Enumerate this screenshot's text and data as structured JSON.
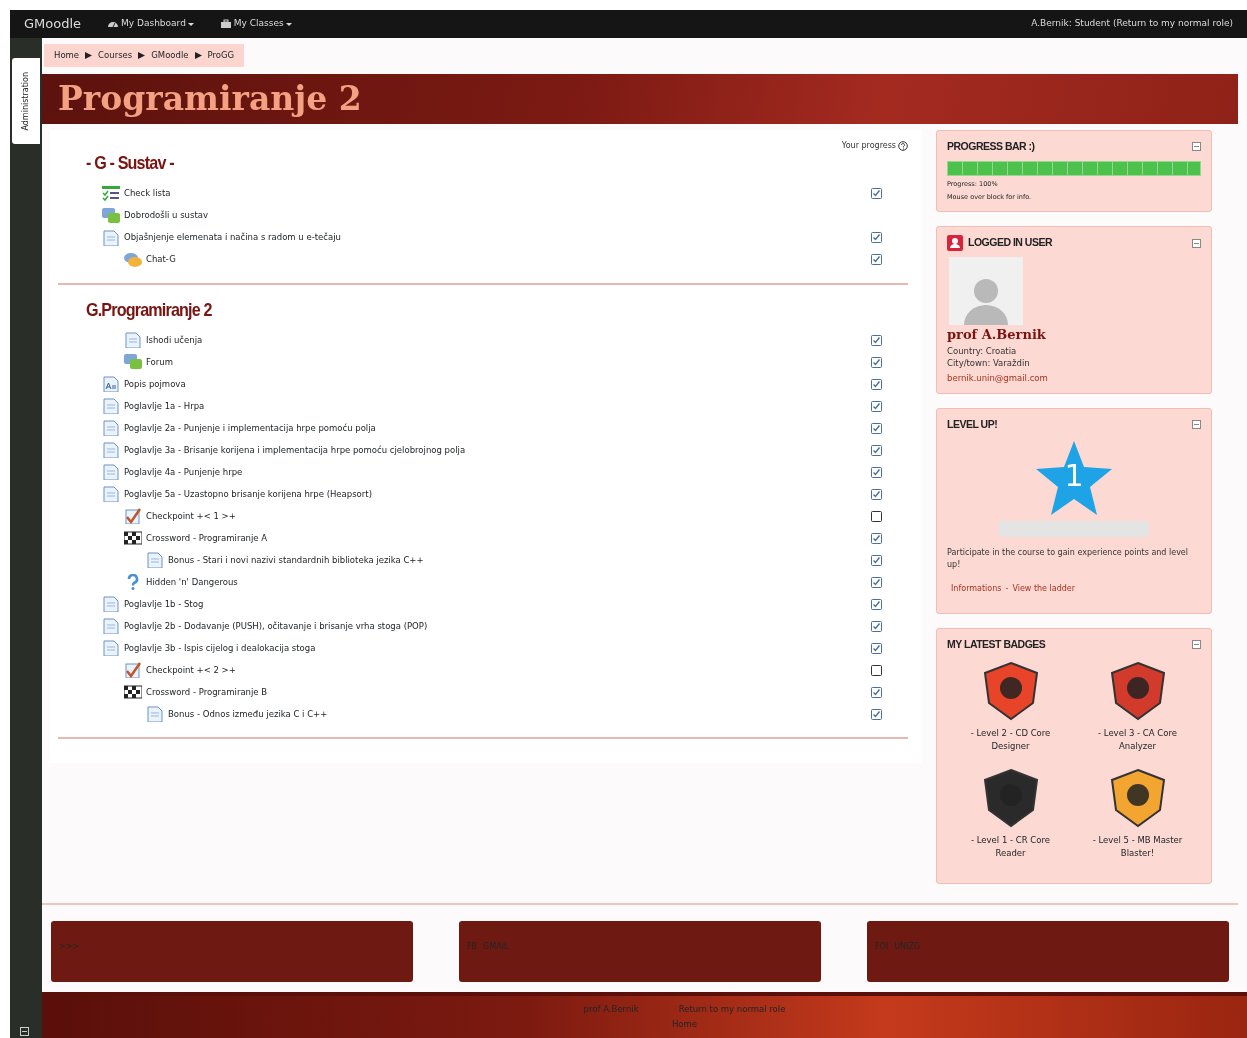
{
  "navbar": {
    "brand": "GMoodle",
    "menus": [
      {
        "label": "My Dashboard"
      },
      {
        "label": "My Classes"
      }
    ],
    "user_text": "A.Bernik: Student (Return to my normal role)"
  },
  "side_tab": {
    "label": "Administration"
  },
  "breadcrumb": [
    {
      "label": "Home"
    },
    {
      "label": "Courses"
    },
    {
      "label": "GMoodle"
    },
    {
      "label": "ProGG"
    }
  ],
  "course_title": "Programiranje 2",
  "progress_header": {
    "label": "Your progress"
  },
  "sections": [
    {
      "title": "- G - Sustav -",
      "activities": [
        {
          "kind": "checklist",
          "label": "Check lista",
          "checked": true
        },
        {
          "kind": "forum",
          "label": "Dobrodošli u sustav"
        },
        {
          "kind": "page",
          "label": "Objašnjenje elemenata i načina s radom u e-tečaju",
          "checked": true,
          "children": [
            {
              "kind": "chat",
              "label": "Chat-G",
              "checked": true
            }
          ]
        }
      ]
    },
    {
      "title": "G.Programiranje 2",
      "activities": [
        {
          "kind": "group",
          "children": [
            {
              "kind": "page",
              "label": "Ishodi učenja",
              "checked": true
            },
            {
              "kind": "forum",
              "label": "Forum",
              "checked": true
            }
          ]
        },
        {
          "kind": "glossary",
          "label": "Popis pojmova",
          "checked": true
        },
        {
          "kind": "page",
          "label": "Poglavlje 1a - Hrpa",
          "checked": true
        },
        {
          "kind": "page",
          "label": "Poglavlje 2a - Punjenje i implementacija hrpe pomoću polja",
          "checked": true
        },
        {
          "kind": "page",
          "label": "Poglavlje 3a - Brisanje korijena i implementacija hrpe pomoću cjelobrojnog polja",
          "checked": true
        },
        {
          "kind": "page",
          "label": "Poglavlje 4a - Punjenje hrpe",
          "checked": true
        },
        {
          "kind": "page",
          "label": "Poglavlje 5a - Uzastopno brisanje korijena hrpe (Heapsort)",
          "checked": true,
          "children": [
            {
              "kind": "checkpoint",
              "label": "Checkpoint +< 1 >+",
              "checked": false
            },
            {
              "kind": "crossword",
              "label": "Crossword - Programiranje A",
              "checked": true,
              "children": [
                {
                  "kind": "page",
                  "label": "Bonus - Stari i novi nazivi standardnih biblioteka jezika C++",
                  "checked": true
                }
              ]
            },
            {
              "kind": "question",
              "label": "Hidden 'n' Dangerous",
              "checked": true
            }
          ]
        },
        {
          "kind": "page",
          "label": "Poglavlje 1b - Stog",
          "checked": true
        },
        {
          "kind": "page",
          "label": "Poglavlje 2b - Dodavanje (PUSH), očitavanje i brisanje vrha stoga (POP)",
          "checked": true
        },
        {
          "kind": "page",
          "label": "Poglavlje 3b - Ispis cijelog i dealokacija stoga",
          "checked": true,
          "children": [
            {
              "kind": "checkpoint",
              "label": "Checkpoint +< 2 >+",
              "checked": false
            },
            {
              "kind": "crossword",
              "label": "Crossword - Programiranje B",
              "checked": true,
              "children": [
                {
                  "kind": "page",
                  "label": "Bonus - Odnos između jezika C i C++",
                  "checked": true
                }
              ]
            }
          ]
        }
      ]
    }
  ],
  "blocks": [
    {
      "kind": "progress",
      "title": "PROGRESS BAR :)",
      "level": 1.0,
      "lines": [
        "Progress: 100%",
        "Mouse over block for info."
      ]
    },
    {
      "kind": "user",
      "title": "LOGGED IN USER",
      "name": "prof A.Bernik",
      "lines": [
        "Country: Croatia",
        "City/town: Varaždin"
      ],
      "email": "bernik.unin@gmail.com"
    },
    {
      "kind": "levelup",
      "title": "LEVEL UP!",
      "level_number": "1",
      "text": "Participate in the course to gain experience points and level up!",
      "links": [
        "Informations",
        "View the ladder"
      ],
      "separator": "-"
    },
    {
      "kind": "badges",
      "title": "MY LATEST BADGES",
      "badges": [
        {
          "label": "- Level 2 - CD Core Designer",
          "color": "#e8442a"
        },
        {
          "label": "- Level 3 - CA Core Analyzer",
          "color": "#d23a2c"
        },
        {
          "label": "- Level 1 - CR Core Reader",
          "color": "#2a2a2a"
        },
        {
          "label": "- Level 5 - MB Master Blaster!",
          "color": "#f2a531"
        }
      ]
    }
  ],
  "footer_cards": [
    {
      "links": [
        ">>>"
      ]
    },
    {
      "links": [
        "FB",
        "GMAIL"
      ]
    },
    {
      "links": [
        "FOI",
        "UNIZG"
      ]
    }
  ],
  "footer": {
    "links": [
      "prof A.Bernik",
      "Return to my normal role",
      "Home"
    ]
  }
}
